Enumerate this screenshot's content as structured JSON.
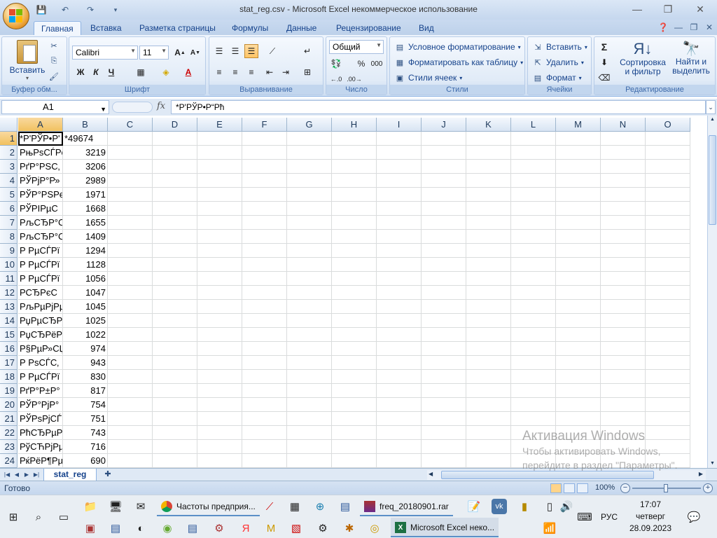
{
  "window": {
    "title": "stat_reg.csv - Microsoft Excel некоммерческое использование",
    "minimize_glyph": "—",
    "restore_glyph": "❐",
    "close_glyph": "✕"
  },
  "ribbon_tabs": [
    "Главная",
    "Вставка",
    "Разметка страницы",
    "Формулы",
    "Данные",
    "Рецензирование",
    "Вид"
  ],
  "ribbon": {
    "clipboard": {
      "label": "Буфер обм...",
      "paste": "Вставить"
    },
    "font": {
      "label": "Шрифт",
      "name": "Calibri",
      "size": "11",
      "bold": "Ж",
      "italic": "К",
      "underline": "Ч"
    },
    "alignment": {
      "label": "Выравнивание"
    },
    "number": {
      "label": "Число",
      "format": "Общий",
      "percent": "%",
      "thousands": "000"
    },
    "styles": {
      "label": "Стили",
      "conditional": "Условное форматирование",
      "as_table": "Форматировать как таблицу",
      "cell_styles": "Стили ячеек"
    },
    "cells": {
      "label": "Ячейки",
      "insert": "Вставить",
      "delete": "Удалить",
      "format": "Формат"
    },
    "editing": {
      "label": "Редактирование",
      "sort": "Сортировка",
      "sort2": "и фильтр",
      "find": "Найти и",
      "find2": "выделить"
    }
  },
  "formula_bar": {
    "name_box": "A1",
    "fx": "fx",
    "content": "*Р'РЎР•Р“Рћ"
  },
  "columns": [
    "A",
    "B",
    "C",
    "D",
    "E",
    "F",
    "G",
    "H",
    "I",
    "J",
    "K",
    "L",
    "M",
    "N",
    "O"
  ],
  "rows": [
    {
      "n": "1",
      "a": "*Р'РЎР•Р'",
      "b": "*49674"
    },
    {
      "n": "2",
      "a": "РњРѕСЃРє",
      "b": "3219"
    },
    {
      "n": "3",
      "a": "РґР°РЅС‚",
      "b": "3206"
    },
    {
      "n": "4",
      "a": "РЎРјР°Р»",
      "b": "2989"
    },
    {
      "n": "5",
      "a": "РЎР°РЅРє",
      "b": "1971"
    },
    {
      "n": "6",
      "a": "РЎРІРµС",
      "b": "1668"
    },
    {
      "n": "7",
      "a": "РљСЂР°С",
      "b": "1655"
    },
    {
      "n": "8",
      "a": "РљСЂР°С",
      "b": "1409"
    },
    {
      "n": "9",
      "a": "Р РµСЃРї",
      "b": "1294"
    },
    {
      "n": "10",
      "a": "Р РµСЃРї",
      "b": "1128"
    },
    {
      "n": "11",
      "a": "Р РµСЃРї",
      "b": "1056"
    },
    {
      "n": "12",
      "a": "РСЂРєС",
      "b": "1047"
    },
    {
      "n": "13",
      "a": "РљРµРјРµ",
      "b": "1045"
    },
    {
      "n": "14",
      "a": "РџРµСЂРј",
      "b": "1025"
    },
    {
      "n": "15",
      "a": "РџСЂРёР",
      "b": "1022"
    },
    {
      "n": "16",
      "a": "Р§РµР»СЏ",
      "b": "974"
    },
    {
      "n": "17",
      "a": "Р РѕСЃС‚",
      "b": "943"
    },
    {
      "n": "18",
      "a": "Р РµСЃРї",
      "b": "830"
    },
    {
      "n": "19",
      "a": "РґР°Р±Р°",
      "b": "817"
    },
    {
      "n": "20",
      "a": "РЎР°РјР°",
      "b": "754"
    },
    {
      "n": "21",
      "a": "РЎРѕРјСЃ",
      "b": "751"
    },
    {
      "n": "22",
      "a": "РћСЂРµР",
      "b": "743"
    },
    {
      "n": "23",
      "a": "РўСЋРјРµ",
      "b": "716"
    },
    {
      "n": "24",
      "a": "РќРёР¶Рµ",
      "b": "690"
    }
  ],
  "sheet": {
    "tab": "stat_reg"
  },
  "status": {
    "ready": "Готово",
    "zoom": "100%"
  },
  "watermark": {
    "title": "Активация Windows",
    "text": "Чтобы активировать Windows, перейдите в раздел \"Параметры\"."
  },
  "taskbar": {
    "chrome_window": "Частоты предприя...",
    "winrar_window": "freq_20180901.rar",
    "excel_window": "Microsoft Excel неко...",
    "lang": "РУС",
    "time": "17:07",
    "day": "четверг",
    "date": "28.09.2023"
  }
}
